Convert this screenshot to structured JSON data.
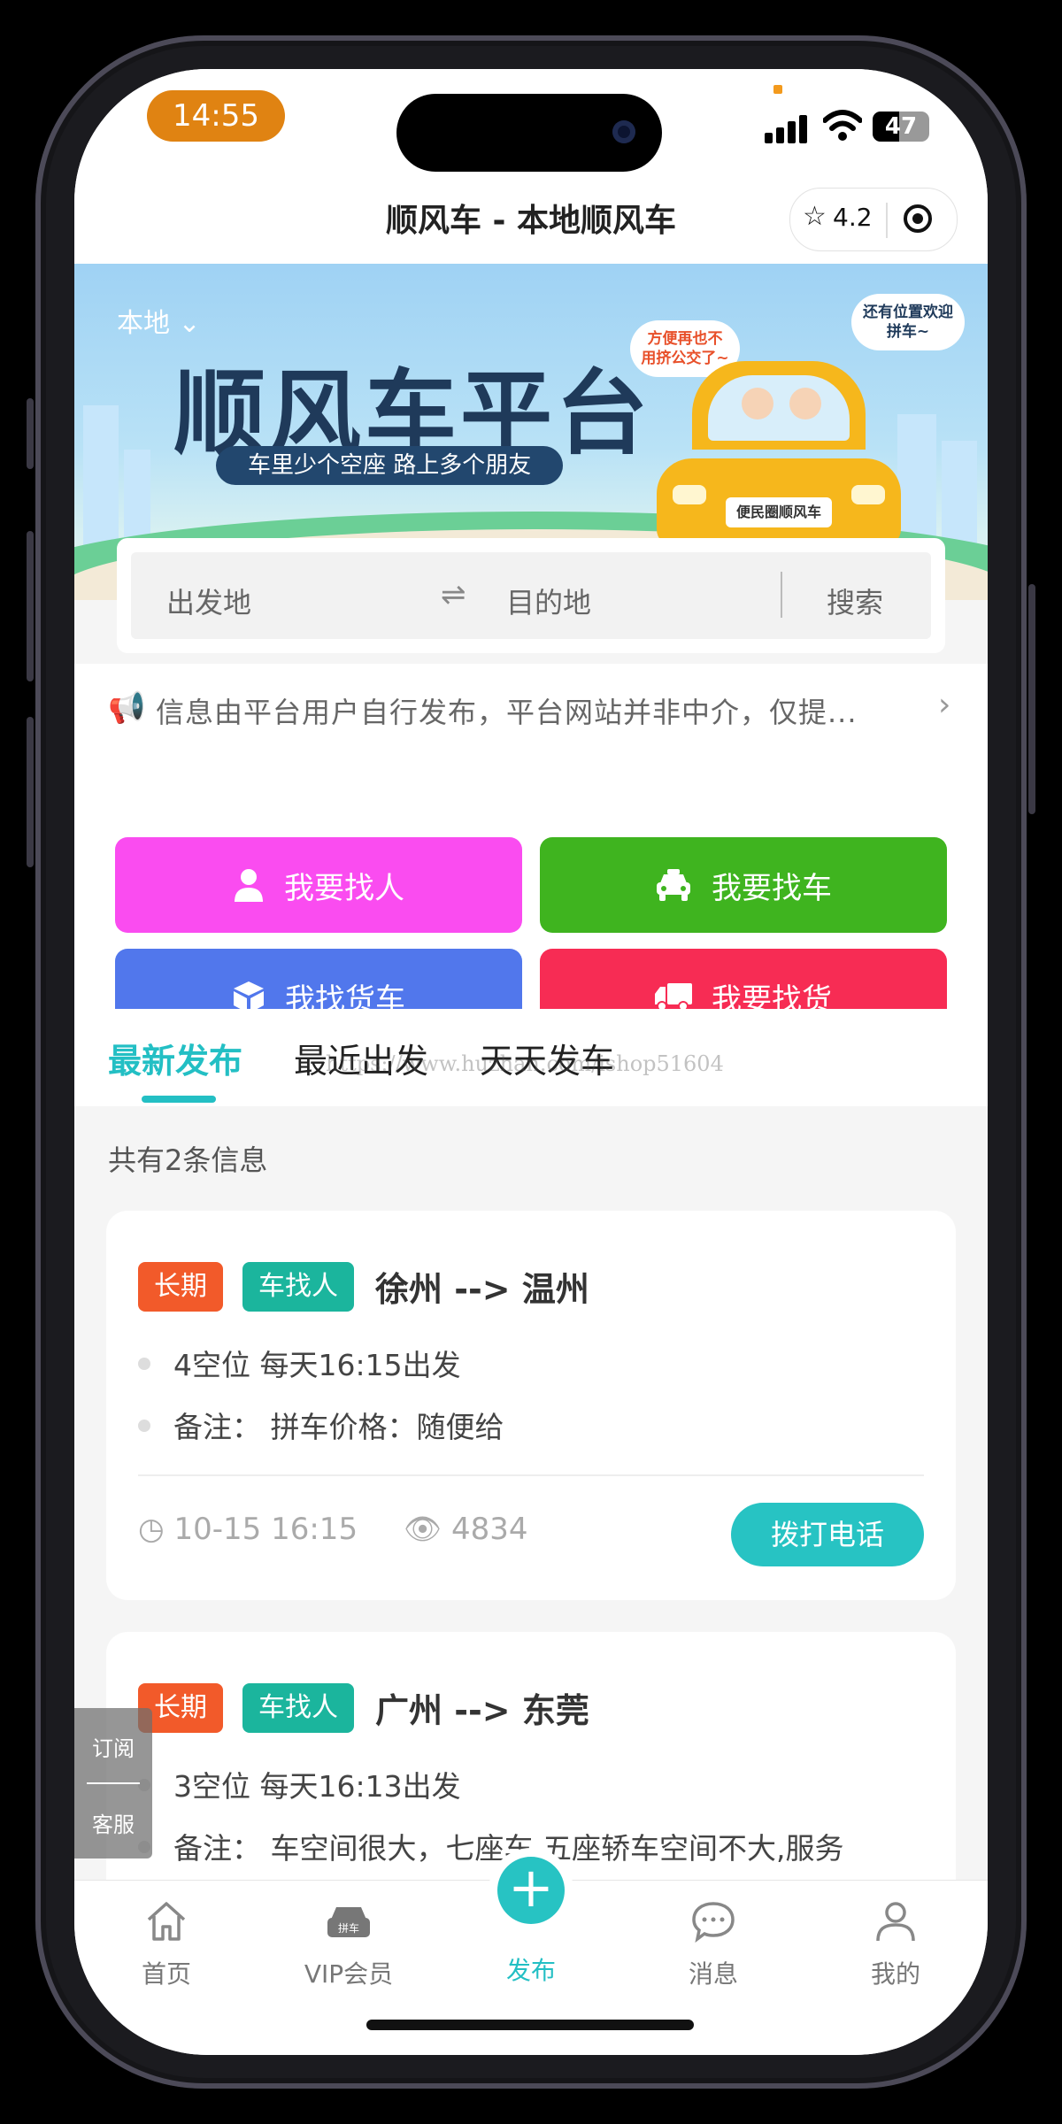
{
  "status": {
    "time": "14:55",
    "battery": "47"
  },
  "navbar": {
    "title": "顺风车 - 本地顺风车",
    "rating": "4.2"
  },
  "banner": {
    "location": "本地",
    "title": "顺风车平台",
    "slogan": "车里少个空座 路上多个朋友",
    "bubble_left": "方便再也不用挤公交了~",
    "bubble_right": "还有位置欢迎拼车~",
    "plate": "便民圈顺风车"
  },
  "search": {
    "from_placeholder": "出发地",
    "to_placeholder": "目的地",
    "button": "搜索"
  },
  "notice": {
    "text": "信息由平台用户自行发布，平台网站并非中介，仅提..."
  },
  "quick_actions": [
    {
      "label": "我要找人",
      "icon": "person-icon",
      "color": "#fa4cf0"
    },
    {
      "label": "我要找车",
      "icon": "car-icon",
      "color": "#3fb41f"
    },
    {
      "label": "我找货车",
      "icon": "box-icon",
      "color": "#5177ec"
    },
    {
      "label": "我要找货",
      "icon": "truck-icon",
      "color": "#f72c54"
    }
  ],
  "tabs": [
    {
      "label": "最新发布",
      "active": true
    },
    {
      "label": "最近出发",
      "active": false
    },
    {
      "label": "天天发车",
      "active": false
    }
  ],
  "watermark": "https://www.huzhan.com/ishop51604",
  "list": {
    "count_text": "共有2条信息"
  },
  "posts": [
    {
      "tag_term": "长期",
      "tag_type": "车找人",
      "route": "徐州 --> 温州",
      "seats": "4空位   每天16:15出发",
      "note": "备注：  拼车价格：随便给",
      "time": "10-15 16:15",
      "views": "4834",
      "call_label": "拨打电话"
    },
    {
      "tag_term": "长期",
      "tag_type": "车找人",
      "route": "广州 --> 东莞",
      "seats": "3空位   每天16:13出发",
      "note": "备注：  车空间很大，七座车,五座轿车空间不大,服务"
    }
  ],
  "float_widget": {
    "subscribe": "订阅",
    "service": "客服"
  },
  "tabbar": [
    {
      "label": "首页",
      "icon": "home-icon"
    },
    {
      "label": "VIP会员",
      "icon": "vip-car-icon",
      "badge": "拼车"
    },
    {
      "label": "发布",
      "icon": "plus-icon",
      "active": true
    },
    {
      "label": "消息",
      "icon": "chat-icon"
    },
    {
      "label": "我的",
      "icon": "user-icon"
    }
  ]
}
